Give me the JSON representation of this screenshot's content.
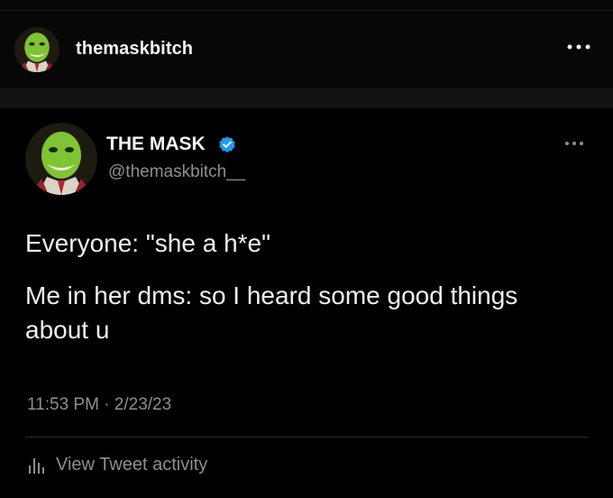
{
  "header": {
    "username": "themaskbitch",
    "more_icon": "more-horizontal-icon"
  },
  "tweet": {
    "display_name": "THE MASK",
    "verified_icon": "verified-badge-icon",
    "handle": "@themaskbitch__",
    "more_icon": "more-horizontal-icon",
    "text_line1": "Everyone: \"she a h*e\"",
    "text_line2": "Me in her dms: so I heard some good things about u",
    "timestamp": "11:53 PM · 2/23/23",
    "activity_label": "View Tweet activity",
    "activity_icon": "bar-chart-icon"
  },
  "colors": {
    "background": "#000000",
    "secondary_text": "#8b8f94",
    "verified_blue": "#1d9bf0",
    "avatar_green": "#7fc432"
  }
}
